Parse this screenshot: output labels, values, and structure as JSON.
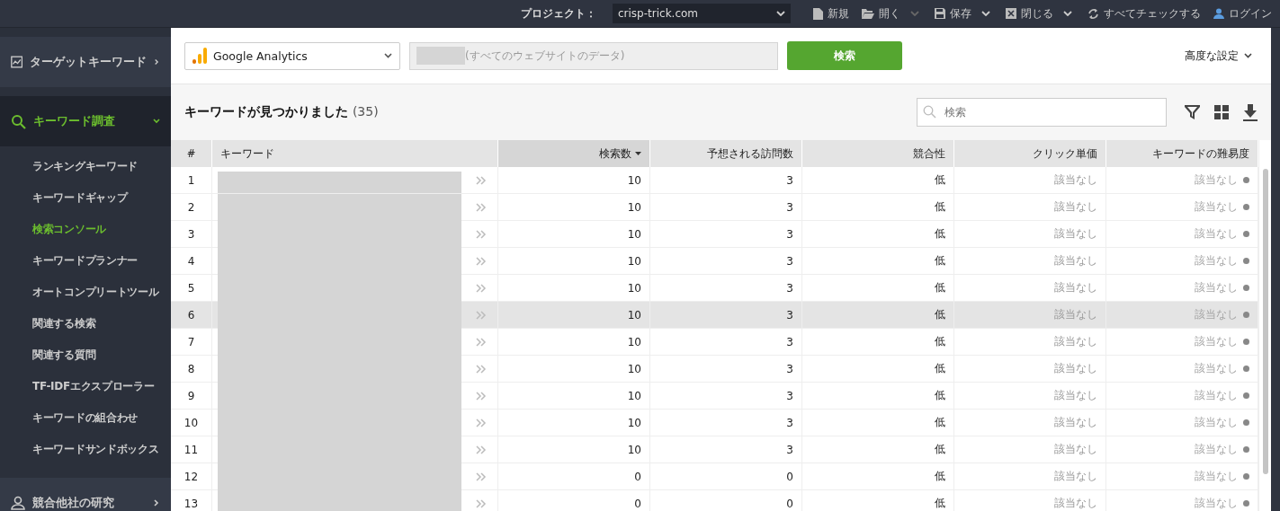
{
  "topbar": {
    "project_label": "プロジェクト：",
    "project": "crisp-trick.com",
    "actions": [
      {
        "kind": "new",
        "label": "新規",
        "menu": false
      },
      {
        "kind": "open",
        "label": "開く",
        "menu": true
      },
      {
        "kind": "save",
        "label": "保存",
        "menu": true
      },
      {
        "kind": "close",
        "label": "閉じる",
        "menu": true
      },
      {
        "kind": "check",
        "label": "すべてチェックする",
        "menu": false
      },
      {
        "kind": "login",
        "label": "ログイン",
        "menu": false
      }
    ]
  },
  "sidebar": {
    "items": [
      {
        "kind": "chart",
        "label": "ターゲットキーワード",
        "expanded": false
      },
      {
        "kind": "search",
        "label": "キーワード調査",
        "expanded": true,
        "children": [
          {
            "label": "ランキングキーワード",
            "selected": false
          },
          {
            "label": "キーワードギャップ",
            "selected": false
          },
          {
            "label": "検索コンソール",
            "selected": true
          },
          {
            "label": "キーワードプランナー",
            "selected": false
          },
          {
            "label": "オートコンプリートツール",
            "selected": false
          },
          {
            "label": "関連する検索",
            "selected": false
          },
          {
            "label": "関連する質問",
            "selected": false
          },
          {
            "label": "TF-IDFエクスプローラー",
            "selected": false
          },
          {
            "label": "キーワードの組合わせ",
            "selected": false
          },
          {
            "label": "キーワードサンドボックス",
            "selected": false
          }
        ]
      },
      {
        "kind": "person",
        "label": "競合他社の研究",
        "expanded": false
      }
    ]
  },
  "toolbar": {
    "source": "Google Analytics",
    "property_hint": "(すべてのウェブサイトのデータ)",
    "search_button": "検索",
    "advanced": "高度な設定"
  },
  "results": {
    "title": "キーワードが見つかりました",
    "count": "(35)",
    "search": {
      "placeholder": "検索"
    }
  },
  "table": {
    "columns": [
      {
        "label": "#",
        "sorted": false
      },
      {
        "label": "キーワード",
        "sorted": false
      },
      {
        "label": "検索数",
        "sorted": true
      },
      {
        "label": "予想される訪問数",
        "sorted": false
      },
      {
        "label": "競合性",
        "sorted": false
      },
      {
        "label": "クリック単価",
        "sorted": false
      },
      {
        "label": "キーワードの難易度",
        "sorted": false
      }
    ],
    "rows": [
      {
        "num": "1",
        "searches": "10",
        "visits": "3",
        "competition": "低",
        "cpc": "該当なし",
        "difficulty": "該当なし",
        "highlighted": false
      },
      {
        "num": "2",
        "searches": "10",
        "visits": "3",
        "competition": "低",
        "cpc": "該当なし",
        "difficulty": "該当なし",
        "highlighted": false
      },
      {
        "num": "3",
        "searches": "10",
        "visits": "3",
        "competition": "低",
        "cpc": "該当なし",
        "difficulty": "該当なし",
        "highlighted": false
      },
      {
        "num": "4",
        "searches": "10",
        "visits": "3",
        "competition": "低",
        "cpc": "該当なし",
        "difficulty": "該当なし",
        "highlighted": false
      },
      {
        "num": "5",
        "searches": "10",
        "visits": "3",
        "competition": "低",
        "cpc": "該当なし",
        "difficulty": "該当なし",
        "highlighted": false
      },
      {
        "num": "6",
        "searches": "10",
        "visits": "3",
        "competition": "低",
        "cpc": "該当なし",
        "difficulty": "該当なし",
        "highlighted": true
      },
      {
        "num": "7",
        "searches": "10",
        "visits": "3",
        "competition": "低",
        "cpc": "該当なし",
        "difficulty": "該当なし",
        "highlighted": false
      },
      {
        "num": "8",
        "searches": "10",
        "visits": "3",
        "competition": "低",
        "cpc": "該当なし",
        "difficulty": "該当なし",
        "highlighted": false
      },
      {
        "num": "9",
        "searches": "10",
        "visits": "3",
        "competition": "低",
        "cpc": "該当なし",
        "difficulty": "該当なし",
        "highlighted": false
      },
      {
        "num": "10",
        "searches": "10",
        "visits": "3",
        "competition": "低",
        "cpc": "該当なし",
        "difficulty": "該当なし",
        "highlighted": false
      },
      {
        "num": "11",
        "searches": "10",
        "visits": "3",
        "competition": "低",
        "cpc": "該当なし",
        "difficulty": "該当なし",
        "highlighted": false
      },
      {
        "num": "12",
        "searches": "0",
        "visits": "0",
        "competition": "低",
        "cpc": "該当なし",
        "difficulty": "該当なし",
        "highlighted": false
      },
      {
        "num": "13",
        "searches": "0",
        "visits": "0",
        "competition": "低",
        "cpc": "該当なし",
        "difficulty": "該当なし",
        "highlighted": false
      }
    ]
  }
}
